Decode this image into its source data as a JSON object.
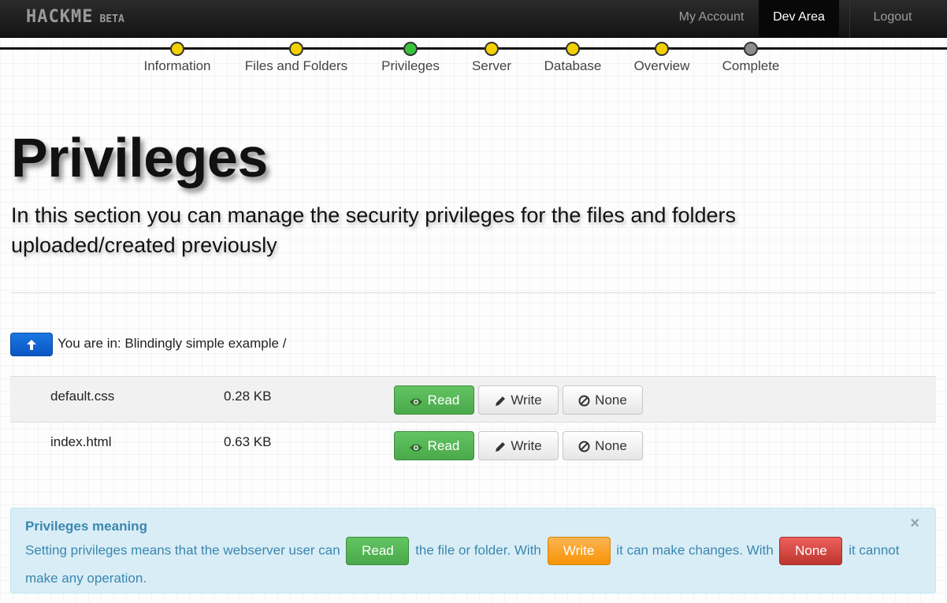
{
  "navbar": {
    "brand": "HACKME",
    "brand_tag": "BETA",
    "links": [
      "My Account",
      "Dev Area",
      "Logout"
    ],
    "active": "Dev Area"
  },
  "wizard": {
    "steps": [
      {
        "label": "Information",
        "state": "done"
      },
      {
        "label": "Files and Folders",
        "state": "done"
      },
      {
        "label": "Privileges",
        "state": "current"
      },
      {
        "label": "Server",
        "state": "pending"
      },
      {
        "label": "Database",
        "state": "pending"
      },
      {
        "label": "Overview",
        "state": "pending"
      },
      {
        "label": "Complete",
        "state": "future"
      }
    ],
    "colors": {
      "done": "#f3d000",
      "current": "#39c33c",
      "future": "#8a8f8c"
    }
  },
  "page": {
    "title": "Privileges",
    "subtitle": "In this section you can manage the security privileges for the files and folders uploaded/created previously"
  },
  "breadcrumb": {
    "up_icon": "arrow-up-icon",
    "path": "You are in: Blindingly simple example /"
  },
  "files": [
    {
      "name": "default.css",
      "size": "0.28 KB",
      "selected": "Read"
    },
    {
      "name": "index.html",
      "size": "0.63 KB",
      "selected": "Read"
    }
  ],
  "privilege_buttons": {
    "read": {
      "label": "Read",
      "icon": "eye-icon"
    },
    "write": {
      "label": "Write",
      "icon": "pencil-icon"
    },
    "none": {
      "label": "None",
      "icon": "ban-icon"
    }
  },
  "alert": {
    "title": "Privileges meaning",
    "close": "×",
    "text_1": "Setting privileges means that the webserver user can",
    "read_label": "Read",
    "text_2": "the file or folder. With",
    "write_label": "Write",
    "text_3": "it can make changes. With",
    "none_label": "None",
    "text_4": "it cannot make any operation.",
    "colors": {
      "read": "#5bb75b",
      "write": "#faa732",
      "none": "#da4f49"
    }
  }
}
